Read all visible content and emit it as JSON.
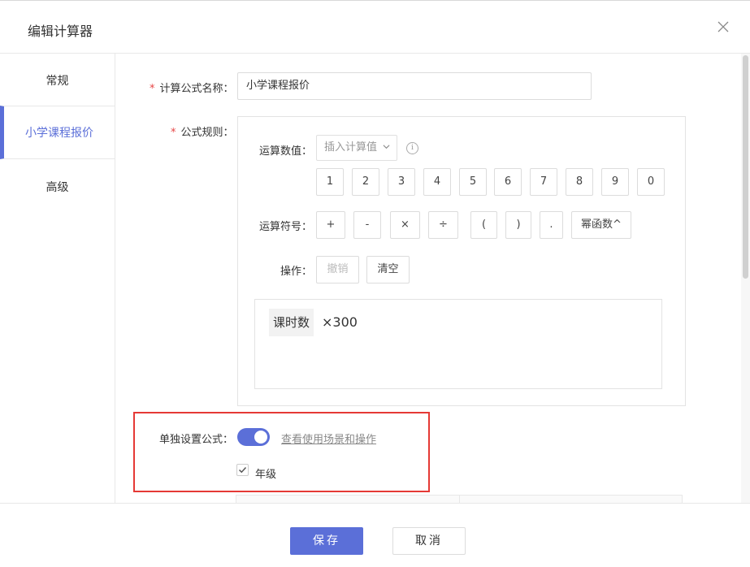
{
  "dialog": {
    "title": "编辑计算器"
  },
  "colors": {
    "accent": "#5b6fd8",
    "required": "#e64545",
    "highlight": "#e53935"
  },
  "sidebar": {
    "items": [
      {
        "label": "常规",
        "active": false
      },
      {
        "label": "小学课程报价",
        "active": true
      },
      {
        "label": "高级",
        "active": false
      }
    ]
  },
  "form": {
    "name_label": "计算公式名称：",
    "name_value": "小学课程报价",
    "rule_label": "公式规则：",
    "required_mark": "*"
  },
  "rule": {
    "values_label": "运算数值：",
    "insert_placeholder": "插入计算值",
    "info_glyph": "i",
    "digits": [
      "1",
      "2",
      "3",
      "4",
      "5",
      "6",
      "7",
      "8",
      "9",
      "0"
    ],
    "operators_label": "运算符号：",
    "operators": [
      "+",
      "-",
      "×",
      "÷",
      "(",
      ")",
      ".",
      "幂函数^"
    ],
    "actions_label": "操作：",
    "undo_label": "撤销",
    "clear_label": "清空",
    "expression": {
      "token": "课时数",
      "rest": "×300"
    }
  },
  "separate": {
    "label": "单独设置公式：",
    "enabled": true,
    "help_link": "查看使用场景和操作",
    "grade_label": "年级",
    "grade_checked": true
  },
  "footer": {
    "save_label": "保存",
    "cancel_label": "取消"
  }
}
